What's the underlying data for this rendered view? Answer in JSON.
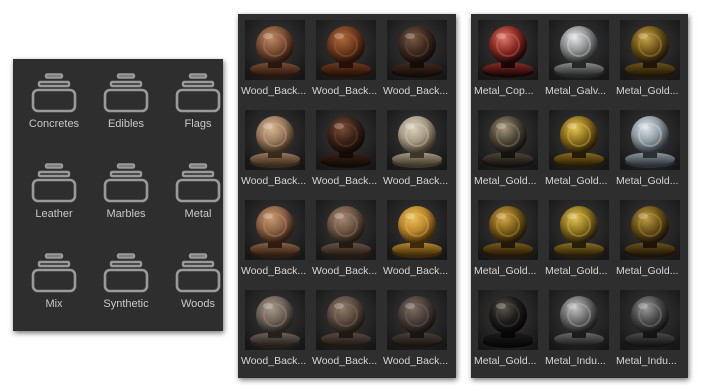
{
  "categories_panel": {
    "items": [
      {
        "label": "Concretes",
        "icon": "folder-icon"
      },
      {
        "label": "Edibles",
        "icon": "folder-icon"
      },
      {
        "label": "Flags",
        "icon": "folder-icon"
      },
      {
        "label": "Leather",
        "icon": "folder-icon"
      },
      {
        "label": "Marbles",
        "icon": "folder-icon"
      },
      {
        "label": "Metal",
        "icon": "folder-icon"
      },
      {
        "label": "Mix",
        "icon": "folder-icon"
      },
      {
        "label": "Synthetic",
        "icon": "folder-icon"
      },
      {
        "label": "Woods",
        "icon": "folder-icon"
      }
    ]
  },
  "wood_panel": {
    "items": [
      {
        "label": "Wood_Back...",
        "base": "#7a4e34",
        "light": "#c08a68",
        "dark": "#2a160c"
      },
      {
        "label": "Wood_Back...",
        "base": "#6e3a1e",
        "light": "#b06a3e",
        "dark": "#241006"
      },
      {
        "label": "Wood_Back...",
        "base": "#3e2a20",
        "light": "#7a5a46",
        "dark": "#140c08"
      },
      {
        "label": "Wood_Back...",
        "base": "#9a7a5e",
        "light": "#d8b894",
        "dark": "#3a2a1c"
      },
      {
        "label": "Wood_Back...",
        "base": "#3a2218",
        "light": "#7a4e3a",
        "dark": "#120a06"
      },
      {
        "label": "Wood_Back...",
        "base": "#a69a86",
        "light": "#dcd2bc",
        "dark": "#3e3628"
      },
      {
        "label": "Wood_Back...",
        "base": "#8a6244",
        "light": "#c89a72",
        "dark": "#2e1c10"
      },
      {
        "label": "Wood_Back...",
        "base": "#6a5444",
        "light": "#a68a72",
        "dark": "#241a12"
      },
      {
        "label": "Wood_Back...",
        "base": "#b8862c",
        "light": "#f0c25a",
        "dark": "#3e2a08"
      },
      {
        "label": "Wood_Back...",
        "base": "#6e6258",
        "light": "#a89a8c",
        "dark": "#24201c"
      },
      {
        "label": "Wood_Back...",
        "base": "#5a4a40",
        "light": "#927a6a",
        "dark": "#1e1812"
      },
      {
        "label": "Wood_Back...",
        "base": "#4a3e38",
        "light": "#7e6e66",
        "dark": "#181412"
      }
    ]
  },
  "metal_panel": {
    "items": [
      {
        "label": "Metal_Cop...",
        "base": "#8a2a24",
        "light": "#e07a6a",
        "dark": "#1a0606"
      },
      {
        "label": "Metal_Galv...",
        "base": "#8a8c8e",
        "light": "#e4e6e8",
        "dark": "#262828"
      },
      {
        "label": "Metal_Gold...",
        "base": "#6e5418",
        "light": "#c8a44a",
        "dark": "#1e1606"
      },
      {
        "label": "Metal_Gold...",
        "base": "#4e4638",
        "light": "#a6987a",
        "dark": "#14120e"
      },
      {
        "label": "Metal_Gold...",
        "base": "#8a6c1a",
        "light": "#e6c656",
        "dark": "#261c06"
      },
      {
        "label": "Metal_Gold...",
        "base": "#8e9aa0",
        "light": "#dfe6ea",
        "dark": "#2a3034"
      },
      {
        "label": "Metal_Gold...",
        "base": "#7a5c18",
        "light": "#d4aa4a",
        "dark": "#221806"
      },
      {
        "label": "Metal_Gold...",
        "base": "#8c701e",
        "light": "#e4c45a",
        "dark": "#261e08"
      },
      {
        "label": "Metal_Gold...",
        "base": "#6a5218",
        "light": "#c09e44",
        "dark": "#1c1406"
      },
      {
        "label": "Metal_Gold...",
        "base": "#1e1c1a",
        "light": "#5a5650",
        "dark": "#060606"
      },
      {
        "label": "Metal_Indu...",
        "base": "#6a6a6a",
        "light": "#c4c4c4",
        "dark": "#1c1c1c"
      },
      {
        "label": "Metal_Indu...",
        "base": "#4a4a4a",
        "light": "#9a9a9a",
        "dark": "#141414"
      }
    ]
  }
}
